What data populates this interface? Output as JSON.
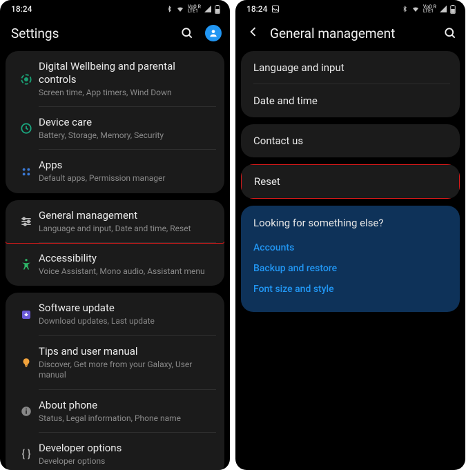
{
  "statusbar": {
    "time": "18:24"
  },
  "left": {
    "title": "Settings",
    "groups": [
      {
        "items": [
          {
            "icon": "wellbeing",
            "title": "Digital Wellbeing and parental controls",
            "sub": "Screen time, App timers, Wind Down"
          },
          {
            "icon": "device-care",
            "title": "Device care",
            "sub": "Battery, Storage, Memory, Security"
          },
          {
            "icon": "apps",
            "title": "Apps",
            "sub": "Default apps, Permission manager"
          }
        ]
      },
      {
        "items": [
          {
            "icon": "general",
            "title": "General management",
            "sub": "Language and input, Date and time, Reset",
            "highlight": true
          },
          {
            "icon": "accessibility",
            "title": "Accessibility",
            "sub": "Voice Assistant, Mono audio, Assistant menu"
          }
        ]
      },
      {
        "items": [
          {
            "icon": "sw-update",
            "title": "Software update",
            "sub": "Download updates, Last update"
          },
          {
            "icon": "tips",
            "title": "Tips and user manual",
            "sub": "Discover, Get more from your Galaxy, User manual"
          },
          {
            "icon": "about",
            "title": "About phone",
            "sub": "Status, Legal information, Phone name"
          },
          {
            "icon": "dev",
            "title": "Developer options",
            "sub": "Developer options"
          }
        ]
      }
    ]
  },
  "right": {
    "title": "General management",
    "groups": [
      {
        "items": [
          {
            "title": "Language and input"
          },
          {
            "title": "Date and time"
          }
        ]
      },
      {
        "items": [
          {
            "title": "Contact us"
          }
        ]
      },
      {
        "items": [
          {
            "title": "Reset",
            "highlight": true
          }
        ]
      }
    ],
    "banner": {
      "question": "Looking for something else?",
      "links": [
        "Accounts",
        "Backup and restore",
        "Font size and style"
      ]
    }
  },
  "icons": {
    "wellbeing": "wellbeing-icon",
    "device-care": "device-care-icon",
    "apps": "apps-icon",
    "general": "sliders-icon",
    "accessibility": "accessibility-icon",
    "sw-update": "download-icon",
    "tips": "lightbulb-icon",
    "about": "info-icon",
    "dev": "code-braces-icon"
  }
}
